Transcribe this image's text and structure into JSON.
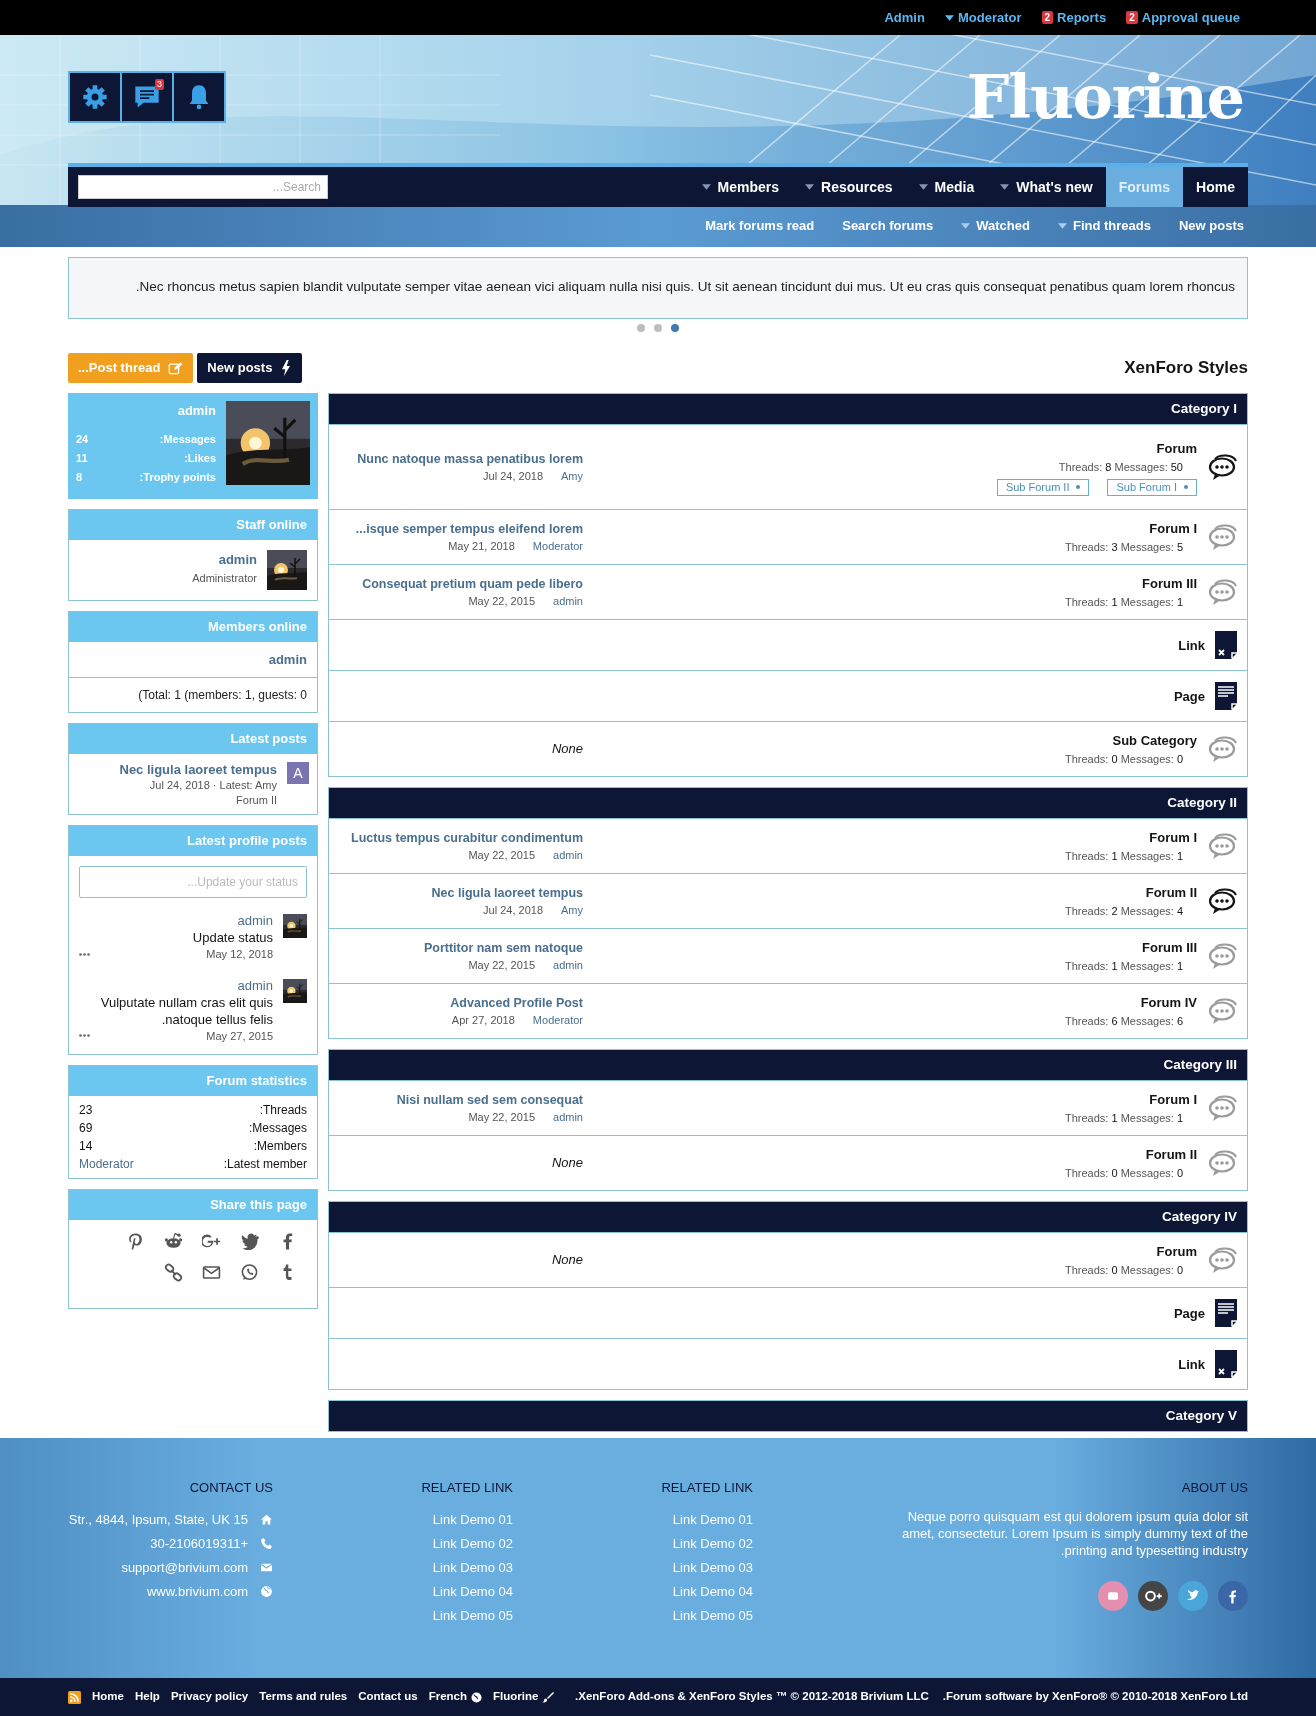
{
  "top_bar": {
    "links": [
      {
        "label": "Admin",
        "has_menu": false
      },
      {
        "label": "Moderator",
        "has_menu": true
      },
      {
        "label": "Reports",
        "has_menu": false,
        "badge": "2"
      },
      {
        "label": "Approval queue",
        "has_menu": false,
        "badge": "2"
      }
    ]
  },
  "header": {
    "logo": "Fluorine",
    "conversations_badge": "3"
  },
  "nav": {
    "search": {
      "placeholder": "...Search"
    },
    "tabs": [
      {
        "label": "Members",
        "has_menu": true,
        "selected": false
      },
      {
        "label": "Resources",
        "has_menu": true,
        "selected": false
      },
      {
        "label": "Media",
        "has_menu": true,
        "selected": false
      },
      {
        "label": "What's new",
        "has_menu": true,
        "selected": false
      },
      {
        "label": "Forums",
        "has_menu": false,
        "selected": true
      },
      {
        "label": "Home",
        "has_menu": false,
        "selected": false
      }
    ]
  },
  "sub_nav": {
    "links": [
      {
        "label": "Mark forums read",
        "has_menu": false
      },
      {
        "label": "Search forums",
        "has_menu": false
      },
      {
        "label": "Watched",
        "has_menu": true
      },
      {
        "label": "Find threads",
        "has_menu": true
      },
      {
        "label": "New posts",
        "has_menu": false
      }
    ]
  },
  "notice": {
    "text": ".Nec rhoncus metus sapien blandit vulputate semper vitae aenean vici aliquam nulla nisi quis. Ut sit aenean tincidunt dui mus. Ut eu cras quis consequat penatibus quam lorem rhoncus",
    "dots": [
      {
        "selected": false
      },
      {
        "selected": false
      },
      {
        "selected": true
      }
    ]
  },
  "actions": [
    {
      "label": "...Post thread",
      "kind": "post"
    },
    {
      "label": "New posts",
      "kind": "new"
    }
  ],
  "page_title": "XenForo Styles",
  "sidebar": {
    "user_card": {
      "name": "admin",
      "stats": [
        {
          "value": "24",
          "label": ":Messages"
        },
        {
          "value": "11",
          "label": ":Likes"
        },
        {
          "value": "8",
          "label": ":Trophy points"
        }
      ]
    },
    "staff_online": {
      "title": "Staff online",
      "members": [
        {
          "name": "admin",
          "role": "Administrator"
        }
      ]
    },
    "members_online": {
      "title": "Members online",
      "names": [
        "admin"
      ],
      "total": "(Total: 1 (members: 1, guests: 0"
    },
    "latest_posts": {
      "title": "Latest posts",
      "items": [
        {
          "title": "Nec ligula laoreet tempus",
          "meta": "Jul 24, 2018 · Latest: Amy",
          "forum": "Forum II",
          "avatar": "A"
        }
      ]
    },
    "latest_profile_posts": {
      "title": "Latest profile posts",
      "placeholder": "...Update your status",
      "posts": [
        {
          "author": "admin",
          "lines": [
            "Update status"
          ],
          "date": "May 12, 2018"
        },
        {
          "author": "admin",
          "lines": [
            "Vulputate nullam cras elit quis",
            ".natoque tellus felis"
          ],
          "date": "May 27, 2015"
        }
      ]
    },
    "forum_statistics": {
      "title": "Forum statistics",
      "rows": [
        {
          "value": "23",
          "label": ":Threads",
          "kind": "plain"
        },
        {
          "value": "69",
          "label": ":Messages",
          "kind": "plain"
        },
        {
          "value": "14",
          "label": ":Members",
          "kind": "plain"
        },
        {
          "value": "Moderator",
          "label": ":Latest member",
          "kind": "link"
        }
      ]
    },
    "share": {
      "title": "Share this page"
    }
  },
  "categories": [
    {
      "title": "Category I",
      "nodes": [
        {
          "kind": "forum",
          "title": "Forum",
          "unread": true,
          "stats": [
            {
              "label": "Threads:",
              "value": "8"
            },
            {
              "label": "Messages:",
              "value": "50"
            }
          ],
          "latest": {
            "title": "Nunc natoque massa penatibus lorem",
            "date": "Jul 24, 2018",
            "user": "Amy"
          },
          "sub_forums": [
            "Sub Forum II",
            "Sub Forum I"
          ]
        },
        {
          "kind": "forum",
          "title": "Forum I",
          "unread": false,
          "stats": [
            {
              "label": "Threads:",
              "value": "3"
            },
            {
              "label": "Messages:",
              "value": "5"
            }
          ],
          "latest": {
            "title": "...isque semper tempus eleifend lorem",
            "date": "May 21, 2018",
            "user": "Moderator"
          }
        },
        {
          "kind": "forum",
          "title": "Forum III",
          "unread": false,
          "stats": [
            {
              "label": "Threads:",
              "value": "1"
            },
            {
              "label": "Messages:",
              "value": "1"
            }
          ],
          "latest": {
            "title": "Consequat pretium quam pede libero",
            "date": "May 22, 2015",
            "user": "admin"
          }
        },
        {
          "kind": "link",
          "title": "Link"
        },
        {
          "kind": "page",
          "title": "Page"
        },
        {
          "kind": "forum",
          "title": "Sub Category",
          "unread": false,
          "stats": [
            {
              "label": "Threads:",
              "value": "0"
            },
            {
              "label": "Messages:",
              "value": "0"
            }
          ],
          "none": "None"
        }
      ]
    },
    {
      "title": "Category II",
      "nodes": [
        {
          "kind": "forum",
          "title": "Forum I",
          "unread": false,
          "stats": [
            {
              "label": "Threads:",
              "value": "1"
            },
            {
              "label": "Messages:",
              "value": "1"
            }
          ],
          "latest": {
            "title": "Luctus tempus curabitur condimentum",
            "date": "May 22, 2015",
            "user": "admin"
          }
        },
        {
          "kind": "forum",
          "title": "Forum II",
          "unread": true,
          "stats": [
            {
              "label": "Threads:",
              "value": "2"
            },
            {
              "label": "Messages:",
              "value": "4"
            }
          ],
          "latest": {
            "title": "Nec ligula laoreet tempus",
            "date": "Jul 24, 2018",
            "user": "Amy"
          }
        },
        {
          "kind": "forum",
          "title": "Forum III",
          "unread": false,
          "stats": [
            {
              "label": "Threads:",
              "value": "1"
            },
            {
              "label": "Messages:",
              "value": "1"
            }
          ],
          "latest": {
            "title": "Porttitor nam sem natoque",
            "date": "May 22, 2015",
            "user": "admin"
          }
        },
        {
          "kind": "forum",
          "title": "Forum IV",
          "unread": false,
          "stats": [
            {
              "label": "Threads:",
              "value": "6"
            },
            {
              "label": "Messages:",
              "value": "6"
            }
          ],
          "latest": {
            "title": "Advanced Profile Post",
            "date": "Apr 27, 2018",
            "user": "Moderator"
          }
        }
      ]
    },
    {
      "title": "Category III",
      "nodes": [
        {
          "kind": "forum",
          "title": "Forum I",
          "unread": false,
          "stats": [
            {
              "label": "Threads:",
              "value": "1"
            },
            {
              "label": "Messages:",
              "value": "1"
            }
          ],
          "latest": {
            "title": "Nisi nullam sed sem consequat",
            "date": "May 22, 2015",
            "user": "admin"
          }
        },
        {
          "kind": "forum",
          "title": "Forum II",
          "unread": false,
          "stats": [
            {
              "label": "Threads:",
              "value": "0"
            },
            {
              "label": "Messages:",
              "value": "0"
            }
          ],
          "none": "None"
        }
      ]
    },
    {
      "title": "Category IV",
      "nodes": [
        {
          "kind": "forum",
          "title": "Forum",
          "unread": false,
          "stats": [
            {
              "label": "Threads:",
              "value": "0"
            },
            {
              "label": "Messages:",
              "value": "0"
            }
          ],
          "none": "None"
        },
        {
          "kind": "page",
          "title": "Page"
        },
        {
          "kind": "link",
          "title": "Link"
        }
      ]
    },
    {
      "title": "Category V"
    }
  ],
  "footer": {
    "contact": {
      "title": "CONTACT US",
      "items": [
        "Str., 4844, Ipsum, State, UK 15",
        "30-2106019311+",
        "support@brivium.com",
        "www.brivium.com"
      ]
    },
    "link_columns": [
      {
        "title": "RELATED LINK",
        "links": [
          "Link Demo 01",
          "Link Demo 02",
          "Link Demo 03",
          "Link Demo 04",
          "Link Demo 05"
        ]
      },
      {
        "title": "RELATED LINK",
        "links": [
          "Link Demo 01",
          "Link Demo 02",
          "Link Demo 03",
          "Link Demo 04",
          "Link Demo 05"
        ]
      }
    ],
    "about": {
      "title": "ABOUT US",
      "lines": [
        "Neque porro quisquam est qui dolorem ipsum quia dolor sit",
        "amet, consectetur. Lorem Ipsum is simply dummy text of the",
        ".printing and typesetting industry"
      ],
      "social": [
        {
          "color": "#e58fb0"
        },
        {
          "color": "#454545"
        },
        {
          "color": "#4aa6d8"
        },
        {
          "color": "#3b66a8"
        }
      ]
    }
  },
  "bottom_bar": {
    "links": [
      "Home",
      "Help",
      "Privacy policy",
      "Terms and rules",
      "Contact us",
      "French",
      "Fluorine"
    ],
    "copyright": [
      ".XenForo Add-ons & XenForo Styles ™ © 2012-2018 Brivium LLC",
      ".Forum software by XenForo® © 2010-2018 XenForo Ltd"
    ]
  }
}
